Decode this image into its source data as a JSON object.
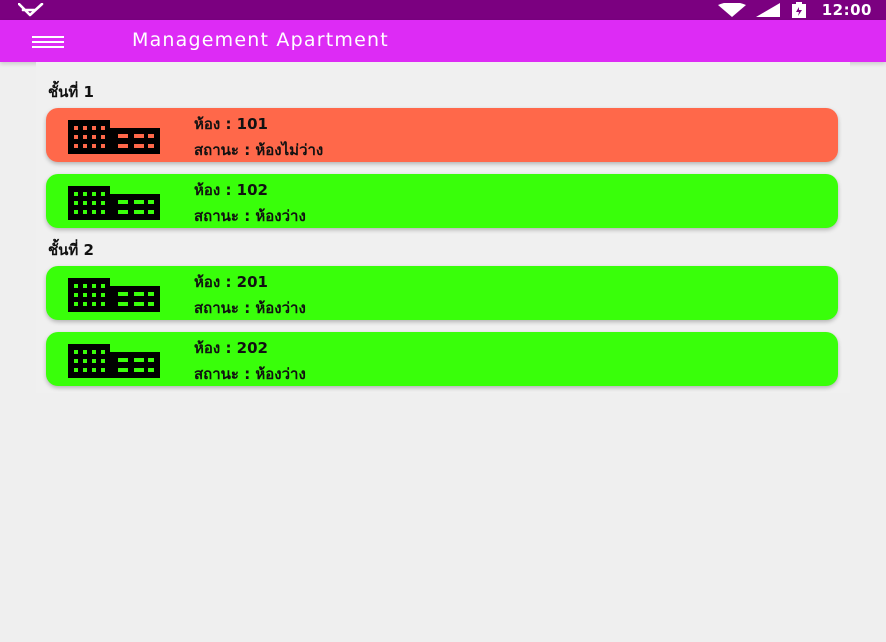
{
  "status_bar": {
    "time": "12:00",
    "icons": [
      "notification-icon",
      "wifi-icon",
      "signal-icon",
      "battery-icon"
    ]
  },
  "app_bar": {
    "menu_icon": "hamburger-menu-icon",
    "title": "Management Apartment",
    "color": "#dd2bf5"
  },
  "floors": [
    {
      "title": "ชั้นที่ 1",
      "rooms": [
        {
          "number": "ห้อง : 101",
          "status": "สถานะ : ห้องไม่ว่าง",
          "color": "#ff684a",
          "icon": "building-icon"
        },
        {
          "number": "ห้อง : 102",
          "status": "สถานะ : ห้องว่าง",
          "color": "#39ff0a",
          "icon": "building-icon"
        }
      ]
    },
    {
      "title": "ชั้นที่ 2",
      "rooms": [
        {
          "number": "ห้อง : 201",
          "status": "สถานะ : ห้องว่าง",
          "color": "#39ff0a",
          "icon": "building-icon"
        },
        {
          "number": "ห้อง : 202",
          "status": "สถานะ : ห้องว่าง",
          "color": "#39ff0a",
          "icon": "building-icon"
        }
      ]
    }
  ]
}
